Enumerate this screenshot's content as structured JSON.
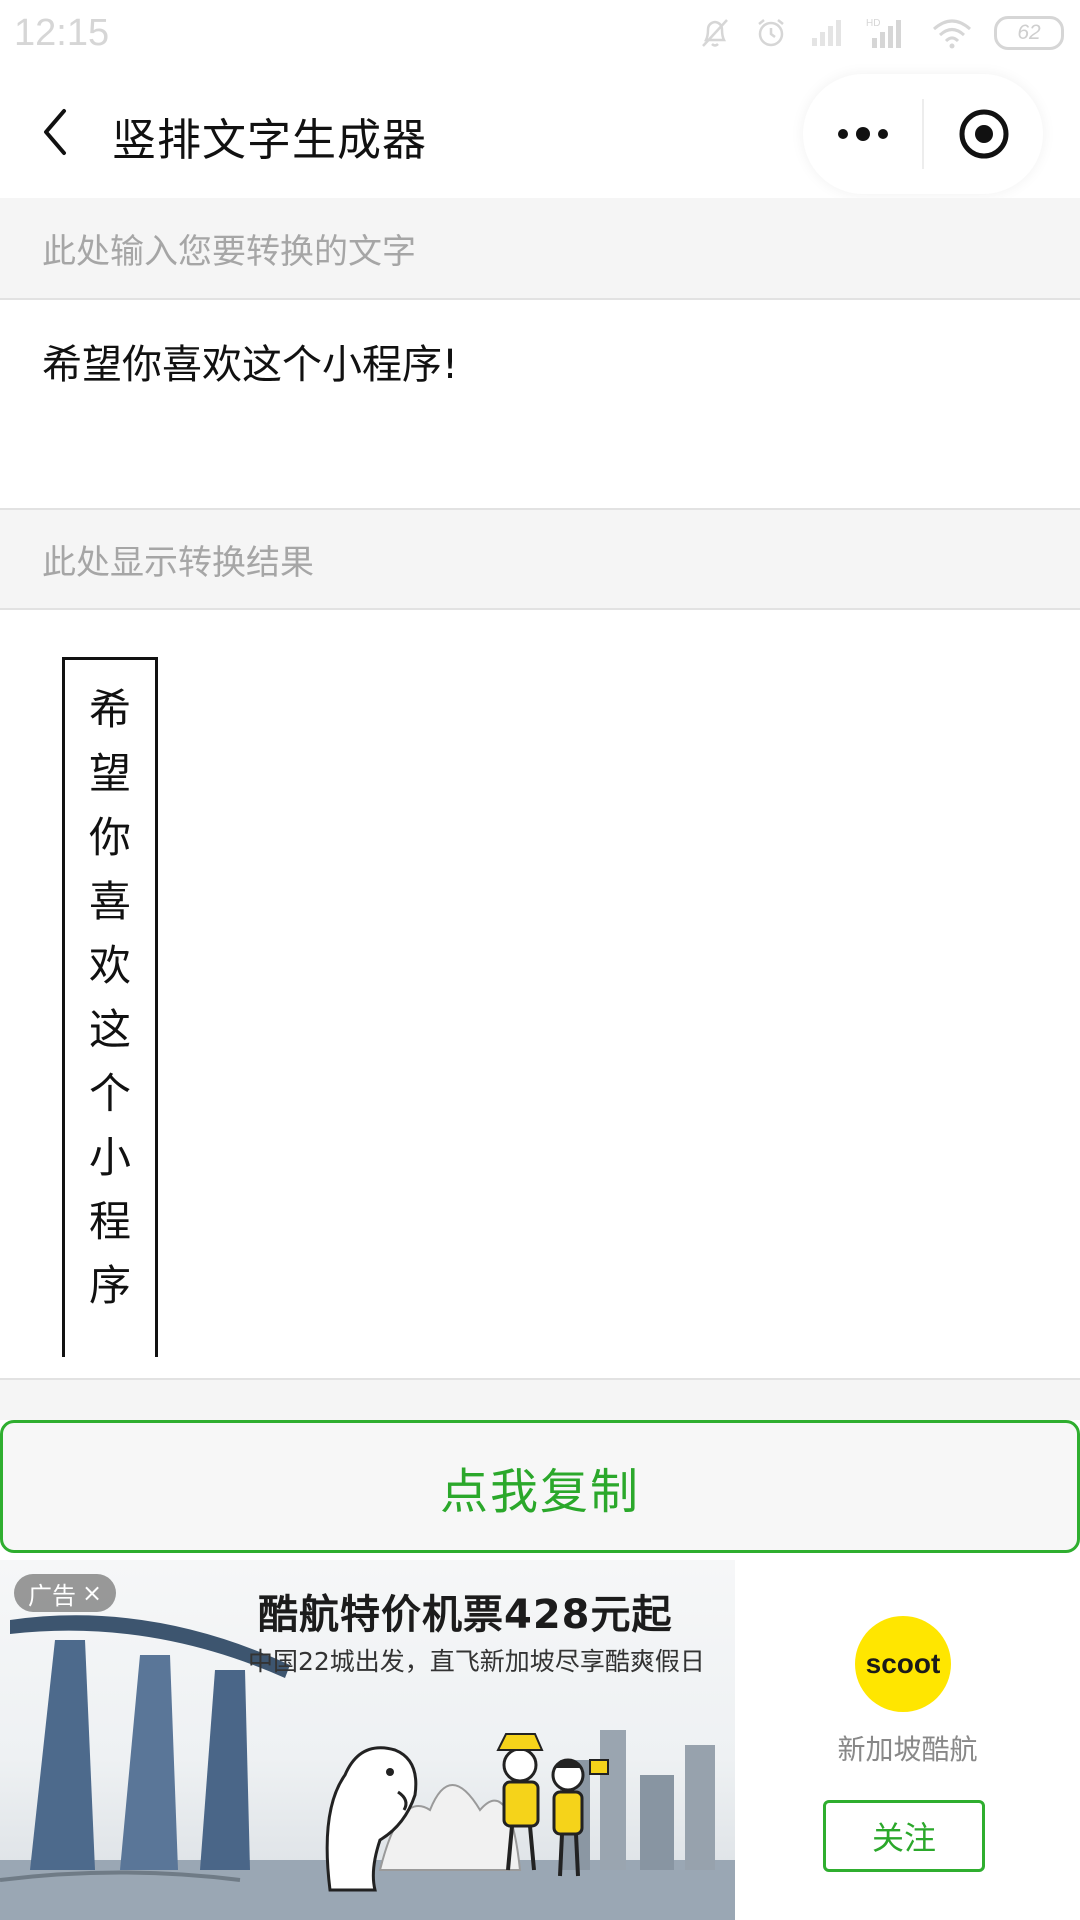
{
  "status_bar": {
    "time": "12:15",
    "battery": "62",
    "icons": [
      "bell-off-icon",
      "alarm-icon",
      "signal-icon",
      "hd-signal-icon",
      "wifi-icon",
      "battery-icon"
    ]
  },
  "nav": {
    "title": "竖排文字生成器",
    "back_icon": "chevron-left-icon",
    "more_icon": "more-dots-icon",
    "close_icon": "target-icon"
  },
  "input_section": {
    "placeholder": "此处输入您要转换的文字",
    "value": "希望你喜欢这个小程序!"
  },
  "result_section": {
    "header": "此处显示转换结果",
    "characters": [
      "希",
      "望",
      "你",
      "喜",
      "欢",
      "这",
      "个",
      "小",
      "程",
      "序"
    ]
  },
  "copy_button": {
    "label": "点我复制"
  },
  "ad": {
    "badge": "广告",
    "badge_close": "×",
    "headline": "酷航特价机票428元起",
    "subline": "中国22城出发，直飞新加坡尽享酷爽假日",
    "brand_logo_text": "scoot",
    "brand_name": "新加坡酷航",
    "follow_label": "关注"
  },
  "colors": {
    "accent_green": "#2ba82b",
    "section_bg": "#f5f5f5",
    "scoot_yellow": "#ffe600"
  }
}
